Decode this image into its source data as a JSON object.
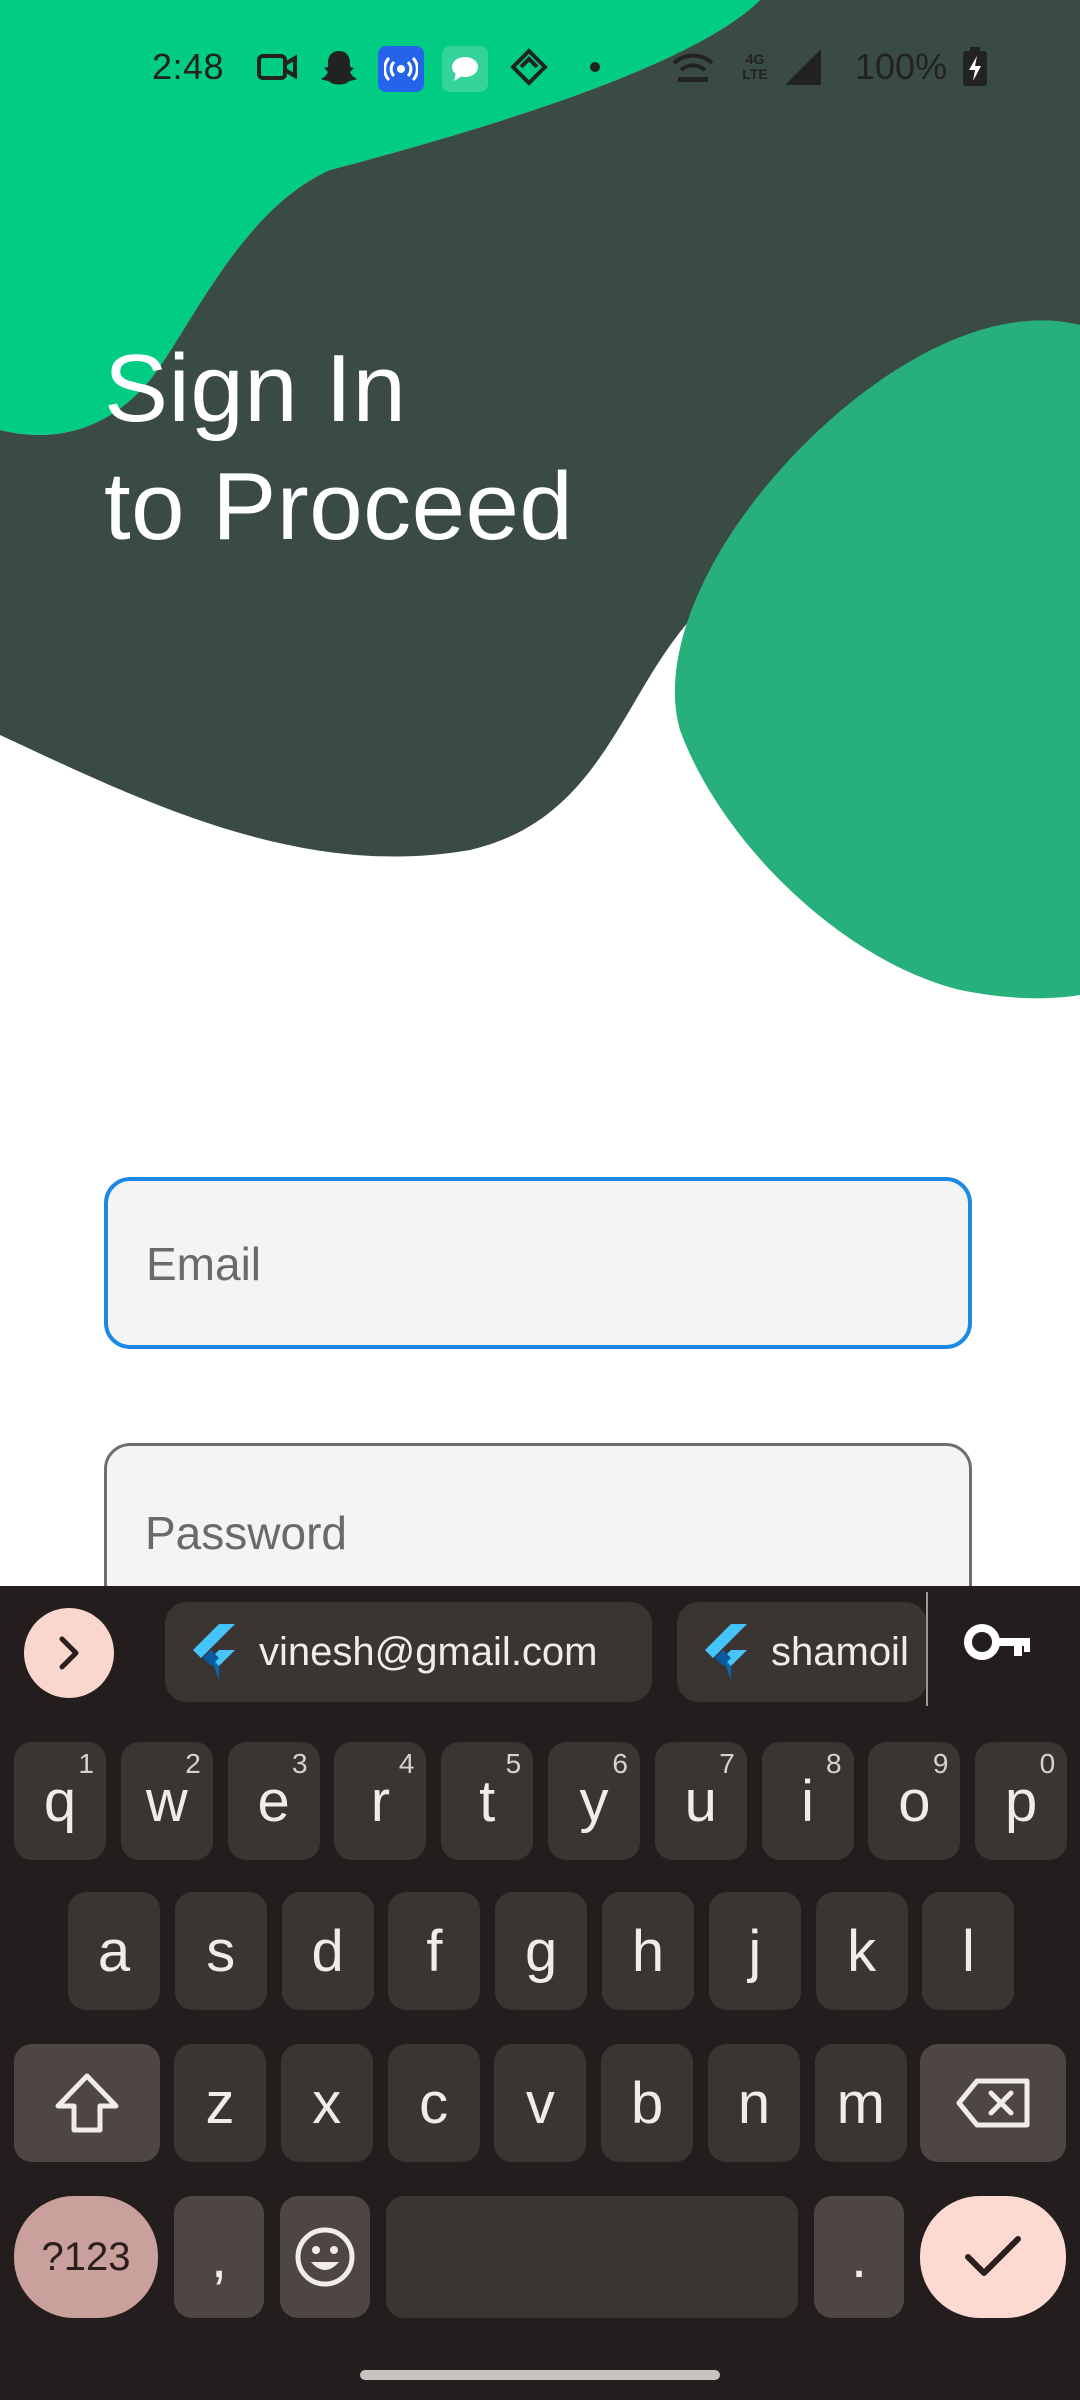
{
  "status_bar": {
    "time": "2:48",
    "battery": "100%",
    "network": "4G LTE",
    "icons": [
      "video-camera-icon",
      "snapchat-icon",
      "hotspot-icon",
      "messages-icon",
      "sync-icon",
      "dot-icon",
      "wifi-calling-icon",
      "cellular-signal-icon",
      "battery-charging-icon"
    ]
  },
  "header": {
    "line1": "Sign In",
    "line2": "to Proceed"
  },
  "form": {
    "email_placeholder": "Email",
    "password_placeholder": "Password"
  },
  "colors": {
    "bright_green": "#00cc82",
    "dark_green": "#3a4a45",
    "mid_green": "#27b07c",
    "focus_blue": "#1e88e5"
  },
  "keyboard": {
    "suggestions": [
      "vinesh@gmail.com",
      "shamoil"
    ],
    "row1": [
      {
        "k": "q",
        "s": "1"
      },
      {
        "k": "w",
        "s": "2"
      },
      {
        "k": "e",
        "s": "3"
      },
      {
        "k": "r",
        "s": "4"
      },
      {
        "k": "t",
        "s": "5"
      },
      {
        "k": "y",
        "s": "6"
      },
      {
        "k": "u",
        "s": "7"
      },
      {
        "k": "i",
        "s": "8"
      },
      {
        "k": "o",
        "s": "9"
      },
      {
        "k": "p",
        "s": "0"
      }
    ],
    "row2": [
      "a",
      "s",
      "d",
      "f",
      "g",
      "h",
      "j",
      "k",
      "l"
    ],
    "row3": [
      "z",
      "x",
      "c",
      "v",
      "b",
      "n",
      "m"
    ],
    "symbols_label": "?123",
    "comma": ",",
    "period": "."
  }
}
